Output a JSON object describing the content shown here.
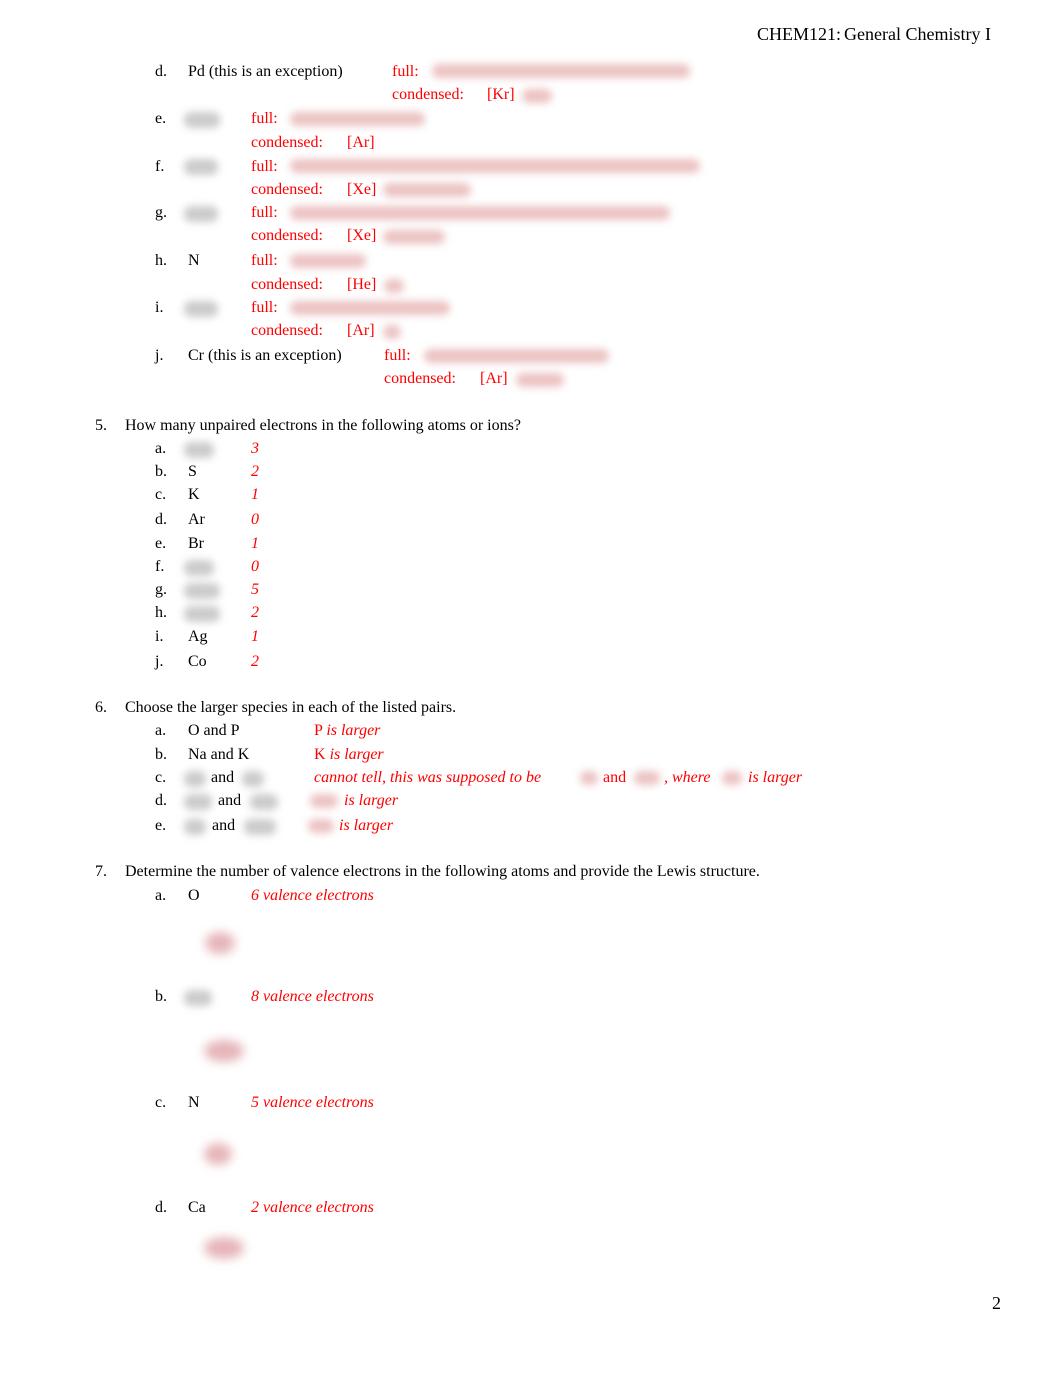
{
  "header": {
    "course": "CHEM121:",
    "title": "General Chemistry I"
  },
  "page_number": "2",
  "q4_continued": {
    "items": [
      {
        "letter": "d.",
        "species": "Pd (this is an exception)",
        "full_label": "full:",
        "condensed_label": "condensed:",
        "core": "[Kr]"
      },
      {
        "letter": "e.",
        "species": "",
        "full_label": "full:",
        "condensed_label": "condensed:",
        "core": "[Ar]"
      },
      {
        "letter": "f.",
        "species": "",
        "full_label": "full:",
        "condensed_label": "condensed:",
        "core": "[Xe]"
      },
      {
        "letter": "g.",
        "species": "",
        "full_label": "full:",
        "condensed_label": "condensed:",
        "core": "[Xe]"
      },
      {
        "letter": "h.",
        "species": "N",
        "full_label": "full:",
        "condensed_label": "condensed:",
        "core": "[He]"
      },
      {
        "letter": "i.",
        "species": "",
        "full_label": "full:",
        "condensed_label": "condensed:",
        "core": "[Ar]"
      },
      {
        "letter": "j.",
        "species": "Cr (this is an exception)",
        "full_label": "full:",
        "condensed_label": "condensed:",
        "core": "[Ar]"
      }
    ]
  },
  "q5": {
    "number": "5.",
    "prompt": "How many unpaired electrons in the following atoms or ions?",
    "items": [
      {
        "letter": "a.",
        "species": "",
        "answer": "3"
      },
      {
        "letter": "b.",
        "species": "S",
        "answer": "2"
      },
      {
        "letter": "c.",
        "species": "K",
        "answer": "1"
      },
      {
        "letter": "d.",
        "species": "Ar",
        "answer": "0"
      },
      {
        "letter": "e.",
        "species": "Br",
        "answer": "1"
      },
      {
        "letter": "f.",
        "species": "",
        "answer": "0"
      },
      {
        "letter": "g.",
        "species": "",
        "answer": "5"
      },
      {
        "letter": "h.",
        "species": "",
        "answer": "2"
      },
      {
        "letter": "i.",
        "species": "Ag",
        "answer": "1"
      },
      {
        "letter": "j.",
        "species": "Co",
        "answer": "2"
      }
    ]
  },
  "q6": {
    "number": "6.",
    "prompt": "Choose the larger species in each of the listed pairs.",
    "items": [
      {
        "letter": "a.",
        "pair": "O and P",
        "answer_species": "P",
        "answer_text": "is larger"
      },
      {
        "letter": "b.",
        "pair": "Na and K",
        "answer_species": "K",
        "answer_text": "is larger"
      },
      {
        "letter": "c.",
        "pair_and": "and",
        "answer_part1": "cannot tell, this was supposed to be",
        "answer_and": "and",
        "answer_part2": ", where",
        "answer_part3": "is larger"
      },
      {
        "letter": "d.",
        "pair_and": "and",
        "answer_text": "is larger"
      },
      {
        "letter": "e.",
        "pair_and": "and",
        "answer_text": "is larger"
      }
    ]
  },
  "q7": {
    "number": "7.",
    "prompt": "Determine the number of valence electrons in the following atoms and provide the Lewis structure.",
    "items": [
      {
        "letter": "a.",
        "species": "O",
        "answer": "6 valence electrons"
      },
      {
        "letter": "b.",
        "species": "",
        "answer": "8 valence electrons"
      },
      {
        "letter": "c.",
        "species": "N",
        "answer": "5 valence electrons"
      },
      {
        "letter": "d.",
        "species": "Ca",
        "answer": "2 valence electrons"
      }
    ]
  }
}
